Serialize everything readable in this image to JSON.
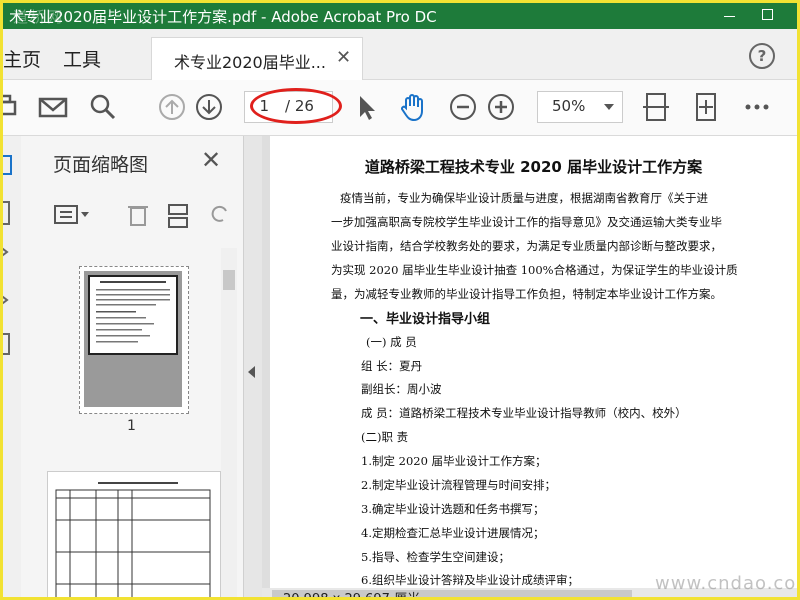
{
  "window": {
    "title": "术专业2020届毕业设计工作方案.pdf - Adobe Acrobat Pro DC",
    "watermark_top": "道桥网"
  },
  "menu": {
    "home": "主页",
    "tools": "工具"
  },
  "tab": {
    "label": "术专业2020届毕业...",
    "close": "✕"
  },
  "help": "?",
  "toolbar": {
    "page_current": "1",
    "page_total": "/ 26",
    "zoom": "50%",
    "icons": [
      "print-icon",
      "mail-icon",
      "search-icon",
      "page-up-icon",
      "page-down-icon",
      "select-pointer-icon",
      "hand-tool-icon",
      "zoom-out-icon",
      "zoom-in-icon",
      "fit-page-icon",
      "full-screen-icon",
      "more-icon"
    ]
  },
  "panel": {
    "title": "页面缩略图",
    "thumb1_label": "1"
  },
  "document": {
    "heading": "道路桥梁工程技术专业 2020 届毕业设计工作方案",
    "lines": [
      "疫情当前，专业为确保毕业设计质量与进度，根据湖南省教育厅《关于进",
      "一步加强高职高专院校学生毕业设计工作的指导意见》及交通运输大类专业毕",
      "业设计指南，结合学校教务处的要求，为满足专业质量内部诊断与整改要求，",
      "为实现 2020 届毕业生毕业设计抽查 100%合格通过，为保证学生的毕业设计质",
      "量，为减轻专业教师的毕业设计指导工作负担，特制定本毕业设计工作方案。"
    ],
    "section1": "一、毕业设计指导小组",
    "sub1": "(一) 成  员",
    "leader": "组  长：夏丹",
    "vice": "副组长：周小波",
    "members": "成  员：道路桥梁工程技术专业毕业设计指导教师（校内、校外）",
    "sub2": "(二)职  责",
    "duties": [
      "1.制定 2020 届毕业设计工作方案；",
      "2.制定毕业设计流程管理与时间安排；",
      "3.确定毕业设计选题和任务书撰写；",
      "4.定期检查汇总毕业设计进展情况；",
      "5.指导、检查学生空间建设；",
      "6.组织毕业设计答辩及毕业设计成绩评审；"
    ]
  },
  "status": {
    "page_size": "20.998 x 29.697 厘米"
  },
  "watermark_bottom": "www.cndao.com"
}
